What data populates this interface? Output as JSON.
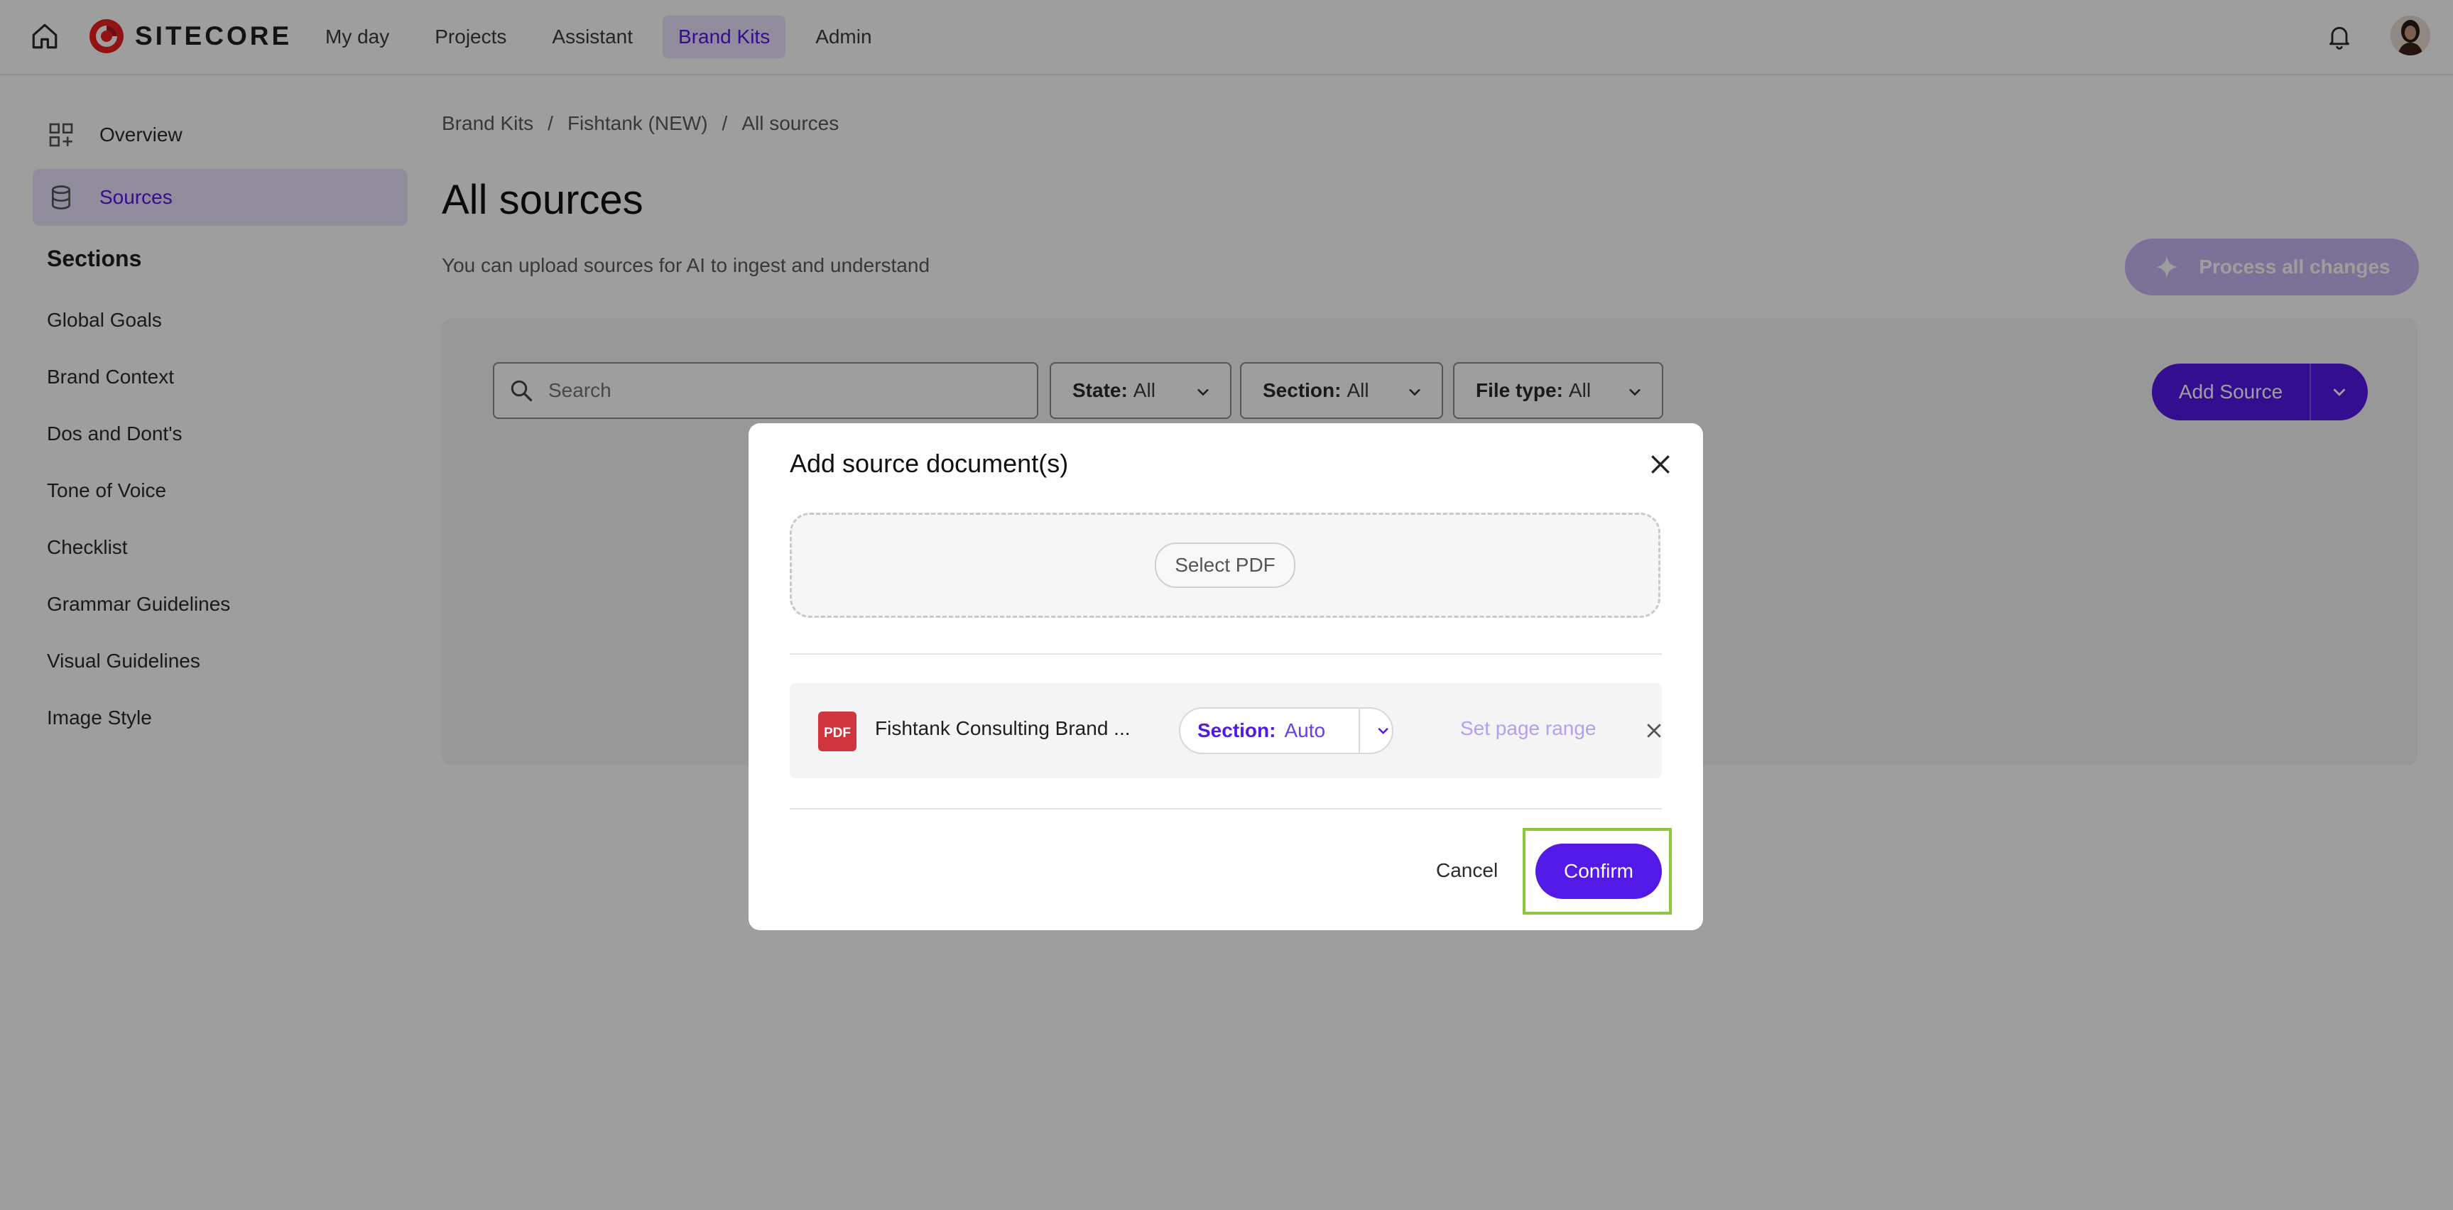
{
  "app": {
    "logo_text": "SITECORE"
  },
  "nav": {
    "items": [
      {
        "label": "My day"
      },
      {
        "label": "Projects"
      },
      {
        "label": "Assistant"
      },
      {
        "label": "Brand Kits"
      },
      {
        "label": "Admin"
      }
    ],
    "active": "Brand Kits"
  },
  "sidebar": {
    "links": [
      {
        "label": "Overview",
        "icon": "grid-plus-icon"
      },
      {
        "label": "Sources",
        "icon": "database-icon"
      }
    ],
    "sections_title": "Sections",
    "sections": [
      "Global Goals",
      "Brand Context",
      "Dos and Dont's",
      "Tone of Voice",
      "Checklist",
      "Grammar Guidelines",
      "Visual Guidelines",
      "Image Style"
    ]
  },
  "breadcrumb": {
    "items": [
      "Brand Kits",
      "Fishtank (NEW)",
      "All sources"
    ],
    "separator": "/"
  },
  "page": {
    "title": "All sources",
    "subtitle": "You can upload sources for AI to ingest and understand",
    "process_button": "Process all changes"
  },
  "filters": {
    "search_placeholder": "Search",
    "state": {
      "label": "State:",
      "value": "All"
    },
    "section": {
      "label": "Section:",
      "value": "All"
    },
    "file_type": {
      "label": "File type:",
      "value": "All"
    },
    "add_source": "Add Source"
  },
  "modal": {
    "title": "Add source document(s)",
    "select_pdf": "Select PDF",
    "file": {
      "icon_text": "PDF",
      "name": "Fishtank Consulting Brand ...",
      "section_label": "Section:",
      "section_value": "Auto",
      "page_range": "Set page range"
    },
    "cancel": "Cancel",
    "confirm": "Confirm"
  },
  "colors": {
    "accent": "#5319e7",
    "accent_light": "#ebe3fb",
    "highlight": "#8dc63f",
    "pdf_red": "#d0343c"
  }
}
